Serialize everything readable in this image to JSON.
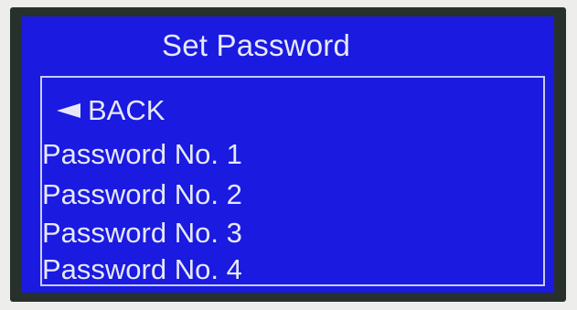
{
  "screen": {
    "title": "Set Password"
  },
  "menu": {
    "back": {
      "icon": "back-arrow-icon",
      "label": "BACK"
    },
    "items": [
      {
        "label": "Password No. 1"
      },
      {
        "label": "Password No. 2"
      },
      {
        "label": "Password No. 3"
      },
      {
        "label": "Password No. 4"
      }
    ]
  },
  "colors": {
    "screen_background": "#1a1ae0",
    "text": "#e6e8f8",
    "bezel": "#27302c"
  }
}
